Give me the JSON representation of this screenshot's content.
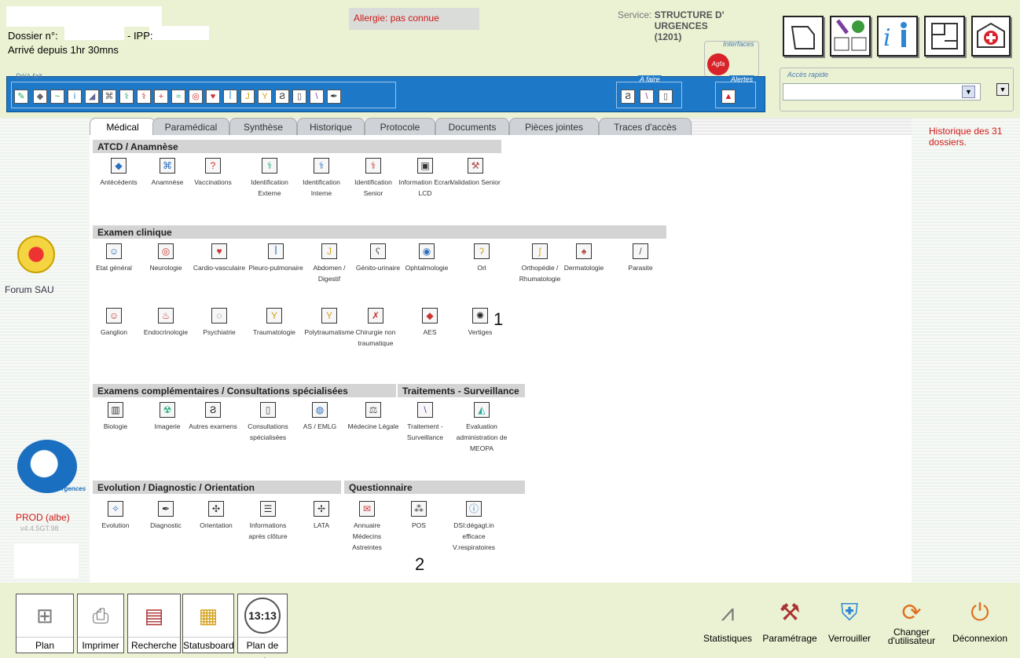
{
  "header": {
    "dossier_label": "Dossier n°:",
    "ipp_label": "- IPP:",
    "arrive": "Arrivé depuis 1hr 30mns",
    "allergie": "Allergie: pas connue",
    "service_label": "Service:",
    "service_value": "STRUCTURE D' URGENCES (1201)",
    "interfaces_label": "Interfaces",
    "interfaces_logo": "Agfa"
  },
  "toolbar_groups": {
    "deja_fait": "Déjà fait",
    "a_faire": "A faire",
    "alertes": "Alertes"
  },
  "acces_rapide": {
    "label": "Accès rapide",
    "value": ""
  },
  "tabs": [
    "Médical",
    "Paramédical",
    "Synthèse",
    "Historique",
    "Protocole",
    "Documents",
    "Pièces jointes",
    "Traces d'accès"
  ],
  "sections": {
    "atcd": "ATCD / Anamnèse",
    "examen": "Examen clinique",
    "complementaires": "Examens complémentaires / Consultations spécialisées",
    "traitements": "Traitements - Surveillance",
    "evolution": "Evolution / Diagnostic / Orientation",
    "questionnaire": "Questionnaire"
  },
  "atcd_items": [
    "Antécédents",
    "Anamnèse",
    "Vaccinations",
    "Identification Externe",
    "Identification Interne",
    "Identification Senior",
    "Information Ecran LCD",
    "Validation Senior"
  ],
  "examen_row1": [
    "Etat général",
    "Neurologie",
    "Cardio-vasculaire",
    "Pleuro-pulmonaire",
    "Abdomen / Digestif",
    "Génito-urinaire",
    "Ophtalmologie",
    "Orl",
    "Orthopédie / Rhumatologie",
    "Dermatologie",
    "Parasite"
  ],
  "examen_row2": [
    "Ganglion",
    "Endocrinologie",
    "Psychiatrie",
    "Traumatologie",
    "Polytraumatisme",
    "Chirurgie non traumatique",
    "AES",
    "Vertiges"
  ],
  "complementaires_items": [
    "Biologie",
    "Imagerie",
    "Autres examens",
    "Consultations spécialisées",
    "AS / EMLG",
    "Médecine Légale"
  ],
  "traitements_items": [
    "Traitement - Surveillance",
    "Evaluation administration de MEOPA"
  ],
  "evolution_items": [
    "Evolution",
    "Diagnostic",
    "Orientation",
    "Informations après clôture",
    "LATA"
  ],
  "questionnaire_items": [
    "Annuaire Médecins Astreintes",
    "POS",
    "DSI:dégagt.in efficace V.respiratoires"
  ],
  "annotations": [
    "1",
    "2"
  ],
  "historique": "Historique des 31 dossiers.",
  "left": {
    "forum": "Forum SAU",
    "brand": "ResUrgences",
    "prod": "PROD (albe)",
    "version": "v4.4.5GT.98"
  },
  "bottom_left": [
    "Plan",
    "Imprimer",
    "Recherche",
    "Statusboard",
    "Plan de soin"
  ],
  "clock": "13:13",
  "bottom_right": [
    "Statistiques",
    "Paramétrage",
    "Verrouiller",
    "Changer d'utilisateur",
    "Déconnexion"
  ]
}
